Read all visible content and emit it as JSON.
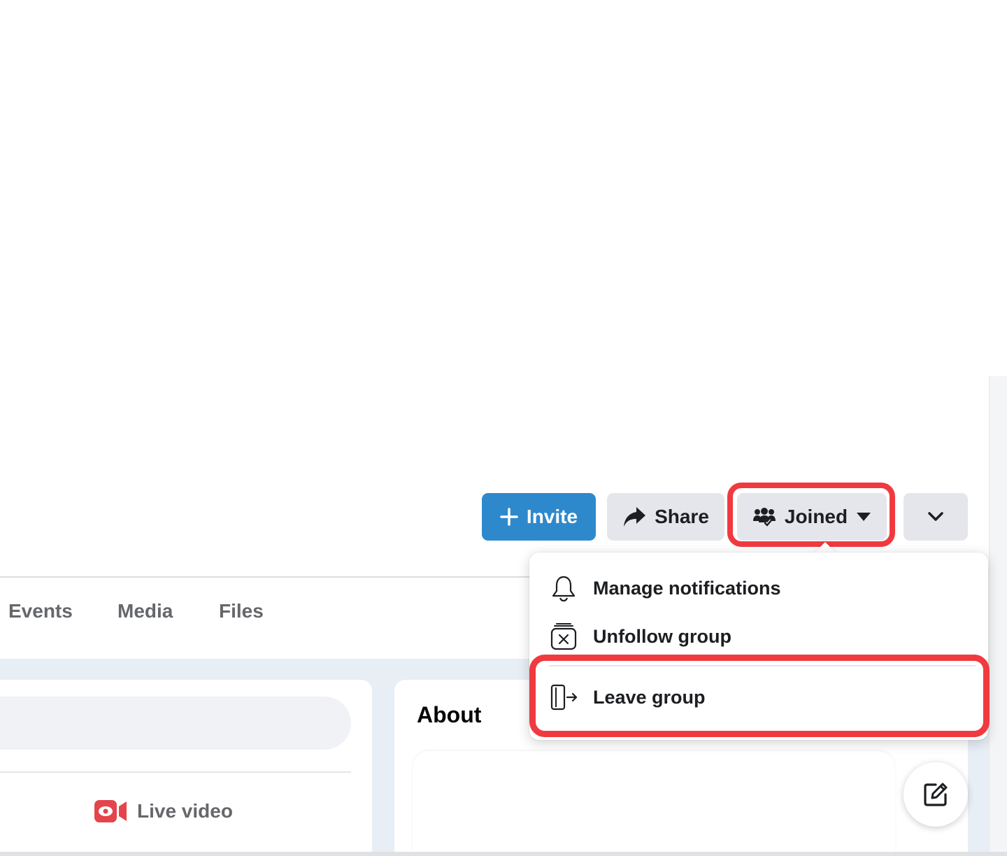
{
  "actions": {
    "invite_label": "Invite",
    "share_label": "Share",
    "joined_label": "Joined"
  },
  "tabs": [
    {
      "label": "Events"
    },
    {
      "label": "Media"
    },
    {
      "label": "Files"
    }
  ],
  "composer": {
    "live_video_label": "Live video"
  },
  "about": {
    "title": "About"
  },
  "menu": {
    "items": [
      {
        "label": "Manage notifications",
        "icon": "bell-icon"
      },
      {
        "label": "Unfollow group",
        "icon": "unfollow-icon"
      },
      {
        "label": "Leave group",
        "icon": "leave-door-icon"
      }
    ]
  },
  "colors": {
    "accent": "#2e89cc",
    "highlight": "#f03a3f",
    "button_gray": "#e4e6eb",
    "live_red": "#e4444c"
  }
}
